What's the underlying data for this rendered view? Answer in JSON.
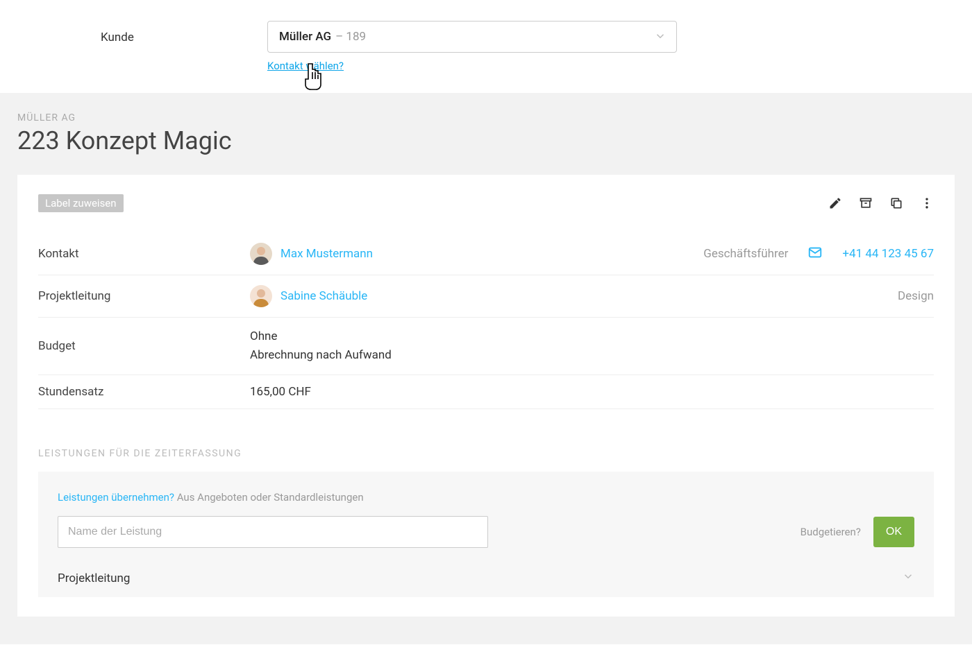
{
  "top_form": {
    "customer_label": "Kunde",
    "customer_name": "Müller AG",
    "customer_suffix": "– 189",
    "contact_link": "Kontakt wählen?"
  },
  "header": {
    "client": "MÜLLER AG",
    "title": "223 Konzept Magic"
  },
  "card": {
    "label_chip": "Label zuweisen",
    "rows": {
      "contact": {
        "label": "Kontakt",
        "name": "Max Mustermann",
        "role": "Geschäftsführer",
        "phone": "+41 44 123 45 67"
      },
      "lead": {
        "label": "Projektleitung",
        "name": "Sabine Schäuble",
        "dept": "Design"
      },
      "budget": {
        "label": "Budget",
        "line1": "Ohne",
        "line2": "Abrechnung nach Aufwand"
      },
      "rate": {
        "label": "Stundensatz",
        "value": "165,00 CHF"
      }
    }
  },
  "services": {
    "section_title": "LEISTUNGEN FÜR DIE ZEITERFASSUNG",
    "hint_link": "Leistungen übernehmen?",
    "hint_gray": "Aus Angeboten oder Standardleistungen",
    "input_placeholder": "Name der Leistung",
    "budget_q": "Budgetieren?",
    "ok": "OK",
    "item1": "Projektleitung"
  }
}
